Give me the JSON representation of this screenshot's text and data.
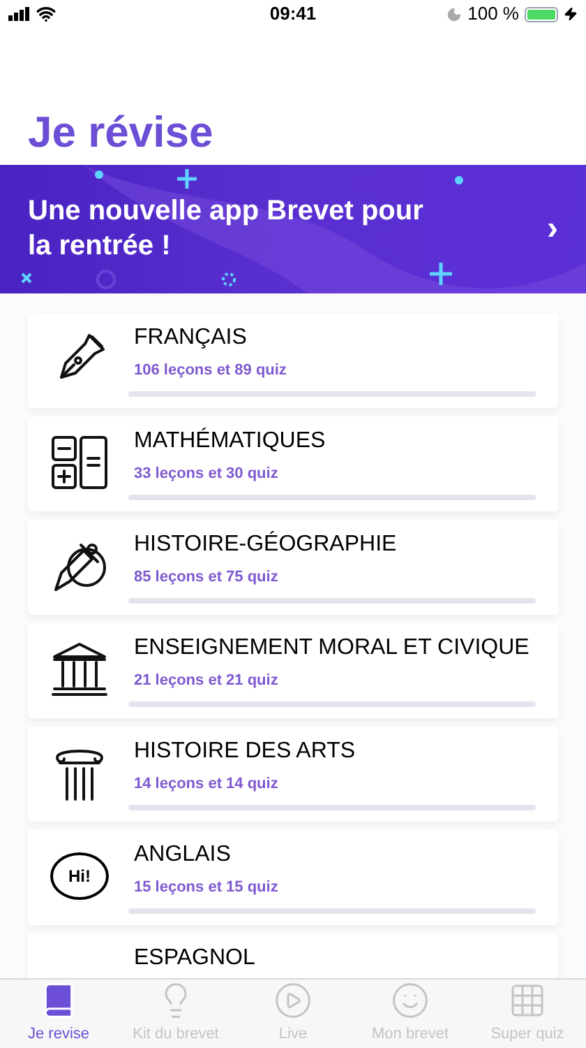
{
  "status_bar": {
    "time": "09:41",
    "battery": "100 %"
  },
  "title": "Je révise",
  "banner": {
    "text": "Une nouvelle app Brevet pour la rentrée !",
    "chevron": "›"
  },
  "subjects": [
    {
      "kind": "pen",
      "name": "FRANÇAIS",
      "count": "106 leçons et 89 quiz"
    },
    {
      "kind": "calculator",
      "name": "MATHÉMATIQUES",
      "count": "33 leçons et 30 quiz"
    },
    {
      "kind": "sword",
      "name": "HISTOIRE-GÉOGRAPHIE",
      "count": "85 leçons et 75 quiz"
    },
    {
      "kind": "building",
      "name": "ENSEIGNEMENT MORAL ET CIVIQUE",
      "count": "21 leçons et 21 quiz"
    },
    {
      "kind": "column",
      "name": "HISTOIRE DES ARTS",
      "count": "14 leçons et 14 quiz"
    },
    {
      "kind": "speech",
      "name": "ANGLAIS",
      "count": "15 leçons et 15 quiz",
      "icon_label": "Hi!"
    },
    {
      "kind": "none",
      "name": "ESPAGNOL"
    }
  ],
  "tabs": [
    {
      "kind": "book",
      "label": "Je revise",
      "selected": true
    },
    {
      "kind": "bulb",
      "label": "Kit du brevet",
      "selected": false
    },
    {
      "kind": "play",
      "label": "Live",
      "selected": false
    },
    {
      "kind": "face",
      "label": "Mon brevet",
      "selected": false
    },
    {
      "kind": "grid",
      "label": "Super quiz",
      "selected": false
    }
  ]
}
